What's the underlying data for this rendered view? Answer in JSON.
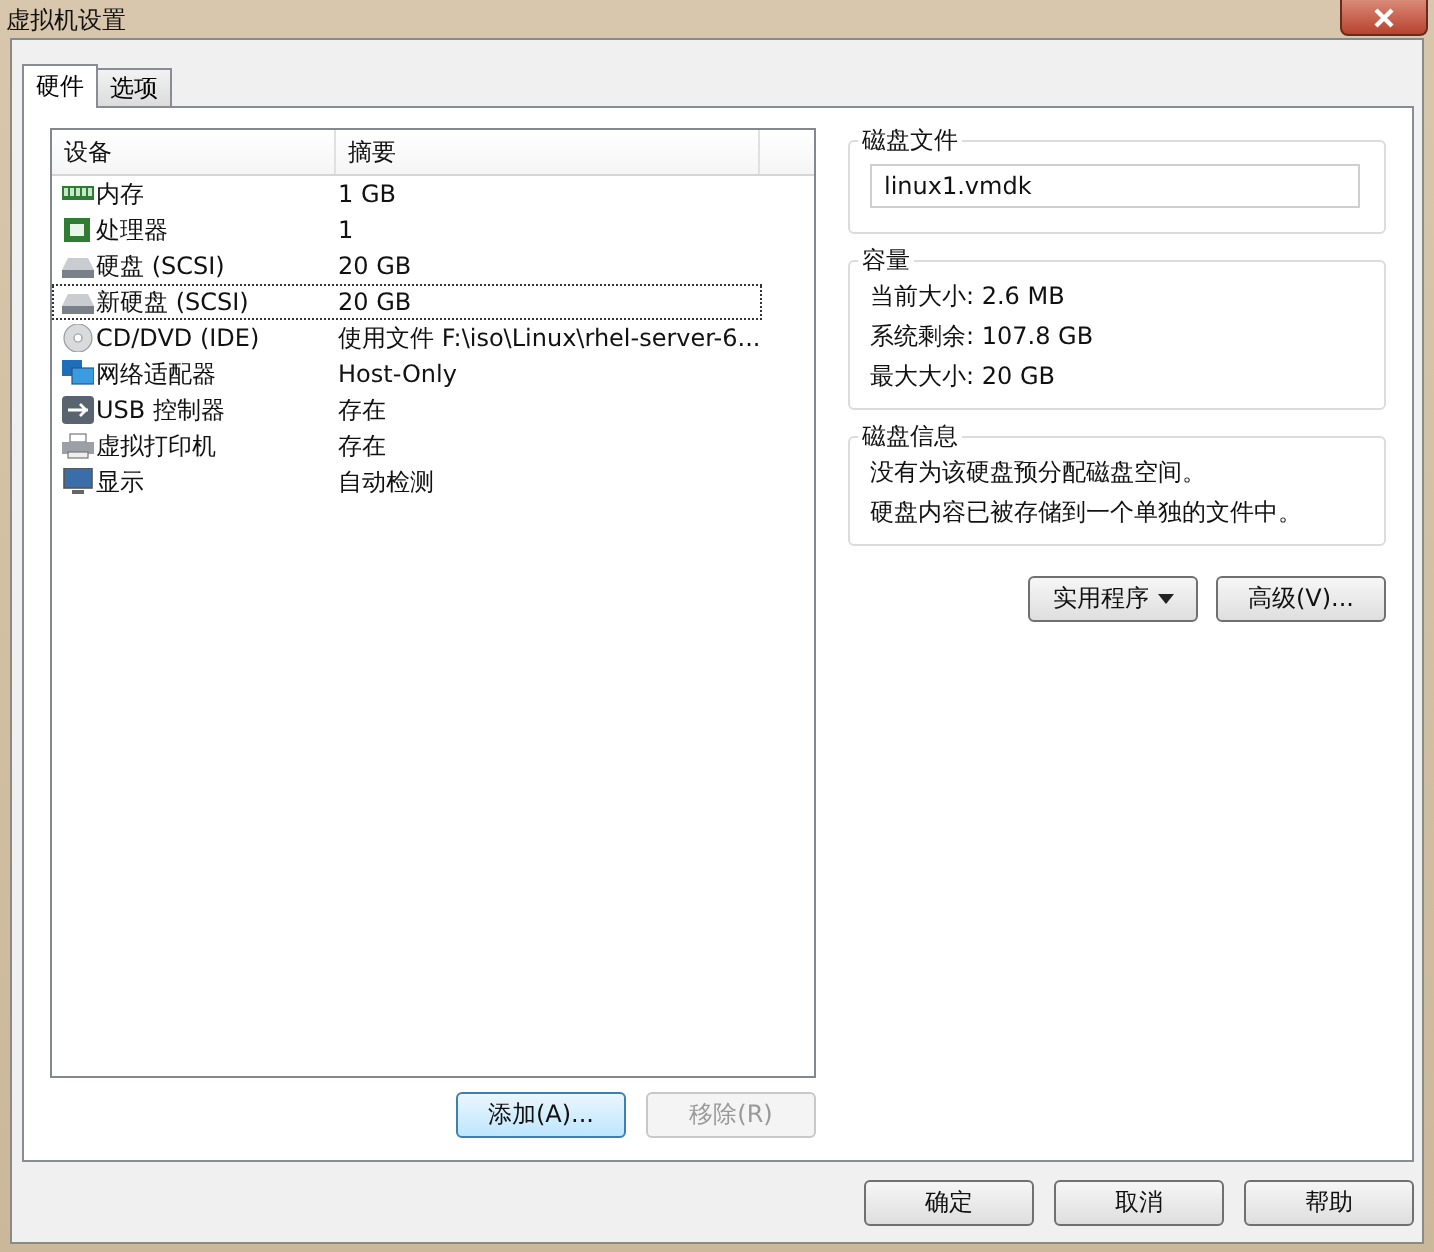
{
  "window": {
    "title": "虚拟机设置"
  },
  "tabs": [
    {
      "label": "硬件",
      "selected": true
    },
    {
      "label": "选项",
      "selected": false
    }
  ],
  "devices": {
    "columns": [
      "设备",
      "摘要"
    ],
    "rows": [
      {
        "kind": "memory",
        "device": "内存",
        "summary": "1 GB",
        "selected": false
      },
      {
        "kind": "cpu",
        "device": "处理器",
        "summary": "1",
        "selected": false
      },
      {
        "kind": "disk",
        "device": "硬盘 (SCSI)",
        "summary": "20 GB",
        "selected": false
      },
      {
        "kind": "disk",
        "device": "新硬盘 (SCSI)",
        "summary": "20 GB",
        "selected": true
      },
      {
        "kind": "cd",
        "device": "CD/DVD (IDE)",
        "summary": "使用文件 F:\\iso\\Linux\\rhel-server-6...",
        "selected": false
      },
      {
        "kind": "network",
        "device": "网络适配器",
        "summary": "Host-Only",
        "selected": false
      },
      {
        "kind": "usb",
        "device": "USB 控制器",
        "summary": "存在",
        "selected": false
      },
      {
        "kind": "printer",
        "device": "虚拟打印机",
        "summary": "存在",
        "selected": false
      },
      {
        "kind": "display",
        "device": "显示",
        "summary": "自动检测",
        "selected": false
      }
    ]
  },
  "list_buttons": [
    {
      "label": "添加(A)...",
      "disabled": false
    },
    {
      "label": "移除(R)",
      "disabled": true
    }
  ],
  "disk_file": {
    "title": "磁盘文件",
    "value": "linux1.vmdk"
  },
  "capacity": {
    "title": "容量",
    "lines": [
      "当前大小: 2.6 MB",
      "系统剩余: 107.8 GB",
      "最大大小: 20 GB"
    ]
  },
  "disk_info": {
    "title": "磁盘信息",
    "lines": [
      "没有为该硬盘预分配磁盘空间。",
      "硬盘内容已被存储到一个单独的文件中。"
    ]
  },
  "side_buttons": [
    {
      "label": "实用程序",
      "dropdown": true
    },
    {
      "label": "高级(V)...",
      "dropdown": false
    }
  ],
  "dialog_buttons": [
    "确定",
    "取消",
    "帮助"
  ]
}
